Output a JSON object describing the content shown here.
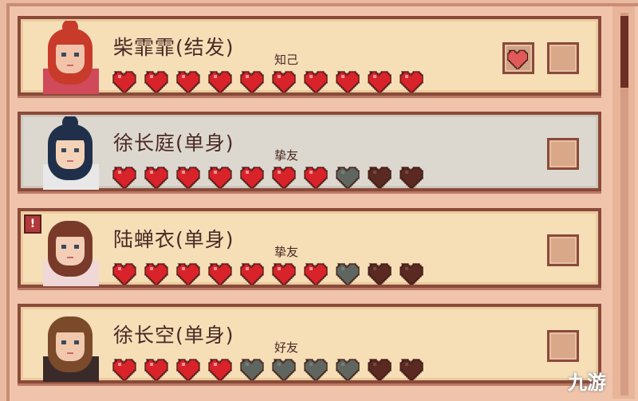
{
  "characters": [
    {
      "name": "柴霏霏(结发)",
      "status": "知己",
      "hearts": [
        "full",
        "full",
        "full",
        "full",
        "full",
        "full",
        "full",
        "full",
        "full",
        "full"
      ],
      "has_heart_button": true,
      "alert": false,
      "selected": false
    },
    {
      "name": "徐长庭(单身)",
      "status": "挚友",
      "hearts": [
        "full",
        "full",
        "full",
        "full",
        "full",
        "full",
        "full",
        "grey",
        "dark",
        "dark"
      ],
      "has_heart_button": false,
      "alert": false,
      "selected": true
    },
    {
      "name": "陆蝉衣(单身)",
      "status": "挚友",
      "hearts": [
        "full",
        "full",
        "full",
        "full",
        "full",
        "full",
        "full",
        "grey",
        "dark",
        "dark"
      ],
      "has_heart_button": false,
      "alert": true,
      "selected": false
    },
    {
      "name": "徐长空(单身)",
      "status": "好友",
      "hearts": [
        "full",
        "full",
        "full",
        "full",
        "grey",
        "grey",
        "grey",
        "grey",
        "dark",
        "dark"
      ],
      "has_heart_button": false,
      "alert": false,
      "selected": false
    }
  ],
  "alert_icon": "!",
  "watermark": "九游",
  "colors": {
    "heart_full": "#d8232a",
    "heart_grey": "#5f6660",
    "heart_dark": "#5a2a22",
    "outline": "#8a4a3a"
  }
}
